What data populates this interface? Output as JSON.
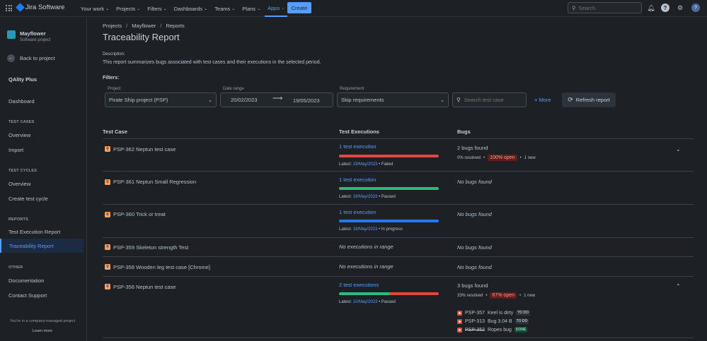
{
  "topbar": {
    "app_name": "Jira Software",
    "nav": [
      {
        "label": "Your work"
      },
      {
        "label": "Projects"
      },
      {
        "label": "Filters"
      },
      {
        "label": "Dashboards"
      },
      {
        "label": "Teams"
      },
      {
        "label": "Plans"
      },
      {
        "label": "Apps"
      }
    ],
    "create_label": "Create",
    "search_placeholder": "Search"
  },
  "sidebar": {
    "project_name": "Mayflower",
    "project_type": "Software project",
    "back_label": "Back to project",
    "app_name": "QAlity Plus",
    "dashboard": "Dashboard",
    "test_cases_heading": "TEST CASES",
    "tc_overview": "Overview",
    "tc_import": "Import",
    "test_cycles_heading": "TEST CYCLES",
    "cy_overview": "Overview",
    "cy_create": "Create test cycle",
    "reports_heading": "REPORTS",
    "r_exec": "Test Execution Report",
    "r_trace": "Traceability Report",
    "other_heading": "OTHER",
    "o_docs": "Documentation",
    "o_support": "Contact Support",
    "footer_text": "You're in a company-managed project",
    "learn_more": "Learn more"
  },
  "page": {
    "breadcrumbs": [
      "Projects",
      "Mayflower",
      "Reports"
    ],
    "title": "Traceability Report",
    "description_label": "Description:",
    "description": "This report summarizes bugs associated with test cases and their executions in the selected period.",
    "filters_label": "Filters:"
  },
  "filters": {
    "project_label": "Project",
    "project_value": "Pirate Ship project (PSP)",
    "date_label": "Date range",
    "date_from": "20/02/2023",
    "date_to": "19/05/2023",
    "req_label": "Requirement",
    "req_value": "Skip requirements",
    "search_placeholder": "Search test case",
    "more_label": "More",
    "refresh_label": "Refresh report"
  },
  "table": {
    "col_test_case": "Test Case",
    "col_exec": "Test Executions",
    "col_bugs": "Bugs",
    "rows": [
      {
        "name": "PSP-362 Neptun test case",
        "exec": "1 test execution",
        "latest_prefix": "Latest:",
        "latest_date": "19/May/2023",
        "latest_status": "• Failed",
        "bugs": "2 bugs found",
        "resolved": "0% resolved",
        "open": "100% open",
        "new": "1 new"
      },
      {
        "name": "PSP-361 Neptun Small Regression",
        "exec": "1 test execution",
        "latest_prefix": "Latest:",
        "latest_date": "19/May/2023",
        "latest_status": "• Passed",
        "bugs": "No bugs found"
      },
      {
        "name": "PSP-360 Trick or treat",
        "exec": "1 test execution",
        "latest_prefix": "Latest:",
        "latest_date": "19/May/2023",
        "latest_status": "• In progress",
        "bugs": "No bugs found"
      },
      {
        "name": "PSP-359 Skeleton strength Test",
        "exec": "No executions in range",
        "bugs": "No bugs found"
      },
      {
        "name": "PSP-358 Wooden leg test case [Chrome]",
        "exec": "No executions in range",
        "bugs": "No bugs found"
      },
      {
        "name": "PSP-356 Neptun test case",
        "exec": "2 test executions",
        "latest_prefix": "Latest:",
        "latest_date": "10/May/2023",
        "latest_status": "• Passed",
        "bugs": "3 bugs found",
        "resolved": "33% resolved",
        "open": "67% open",
        "new": "1 new",
        "bug_list": [
          {
            "key": "PSP-357",
            "title": "Keel is dirty",
            "status": "TO DO"
          },
          {
            "key": "PSP-313",
            "title": "Bug 3.04 B",
            "status": "TO DO"
          },
          {
            "key": "PSP-352",
            "title": "Ropes bug",
            "status": "DONE"
          }
        ]
      }
    ]
  },
  "colors": {
    "failed": "#e2483d",
    "passed": "#2abb7f",
    "in_progress": "#1d7afc",
    "accent": "#579dff"
  }
}
